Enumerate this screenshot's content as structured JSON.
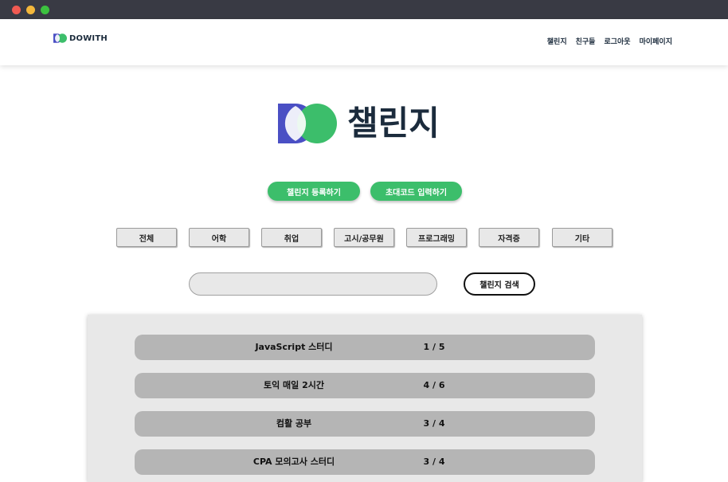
{
  "window": {
    "controls": [
      "close",
      "minimize",
      "maximize"
    ]
  },
  "header": {
    "logo_text": "DOWITH",
    "nav": [
      "챌린지",
      "친구들",
      "로그아웃",
      "마이페이지"
    ]
  },
  "hero": {
    "title": "챌린지",
    "logo_icon": "do-logo-icon"
  },
  "actions": {
    "register": "챌린지 등록하기",
    "invite_code": "초대코드 입력하기"
  },
  "categories": [
    "전체",
    "어학",
    "취업",
    "고시/공무원",
    "프로그래밍",
    "자격증",
    "기타"
  ],
  "search": {
    "value": "",
    "placeholder": "",
    "button": "챌린지 검색"
  },
  "challenges": [
    {
      "name": "JavaScript 스터디",
      "members": "1 / 5"
    },
    {
      "name": "토익 매일 2시간",
      "members": "4 / 6"
    },
    {
      "name": "컴활 공부",
      "members": "3 / 4"
    },
    {
      "name": "CPA 모의고사 스터디",
      "members": "3 / 4"
    }
  ],
  "colors": {
    "brand_blue": "#4a4fc4",
    "brand_green": "#3cbe6b",
    "titlebar": "#393a44",
    "navy_text": "#1b2b3c",
    "row_bg": "#b5b5b5",
    "panel_bg": "#e8e8e8"
  }
}
